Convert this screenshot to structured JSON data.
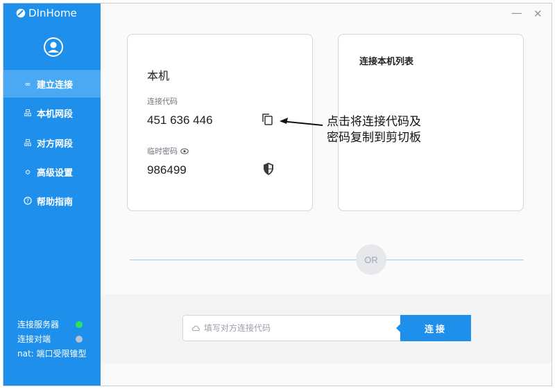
{
  "app": {
    "title": "DInHome"
  },
  "window": {
    "minimize": "—",
    "close": "✕"
  },
  "sidebar": {
    "items": [
      {
        "label": "建立连接",
        "icon": "link-icon",
        "active": true
      },
      {
        "label": "本机网段",
        "icon": "network-icon",
        "active": false
      },
      {
        "label": "对方网段",
        "icon": "network-icon",
        "active": false
      },
      {
        "label": "高级设置",
        "icon": "sliders-icon",
        "active": false
      },
      {
        "label": "帮助指南",
        "icon": "help-icon",
        "active": false
      }
    ],
    "status": {
      "server_label": "连接服务器",
      "server_color": "#2ee05a",
      "peer_label": "连接对端",
      "peer_color": "#b8c3d0",
      "nat_text": "nat: 端口受限锥型"
    }
  },
  "local": {
    "title": "本机",
    "code_label": "连接代码",
    "code_value": "451 636 446",
    "password_label": "临时密码",
    "password_value": "986499"
  },
  "list": {
    "title": "连接本机列表"
  },
  "annotation": {
    "line1": "点击将连接代码及",
    "line2": "密码复制到剪切板"
  },
  "divider": {
    "label": "OR"
  },
  "connect": {
    "placeholder": "填写对方连接代码",
    "button_label": "连接"
  },
  "colors": {
    "accent": "#1e90ec",
    "active_nav": "#4aa9f2"
  }
}
